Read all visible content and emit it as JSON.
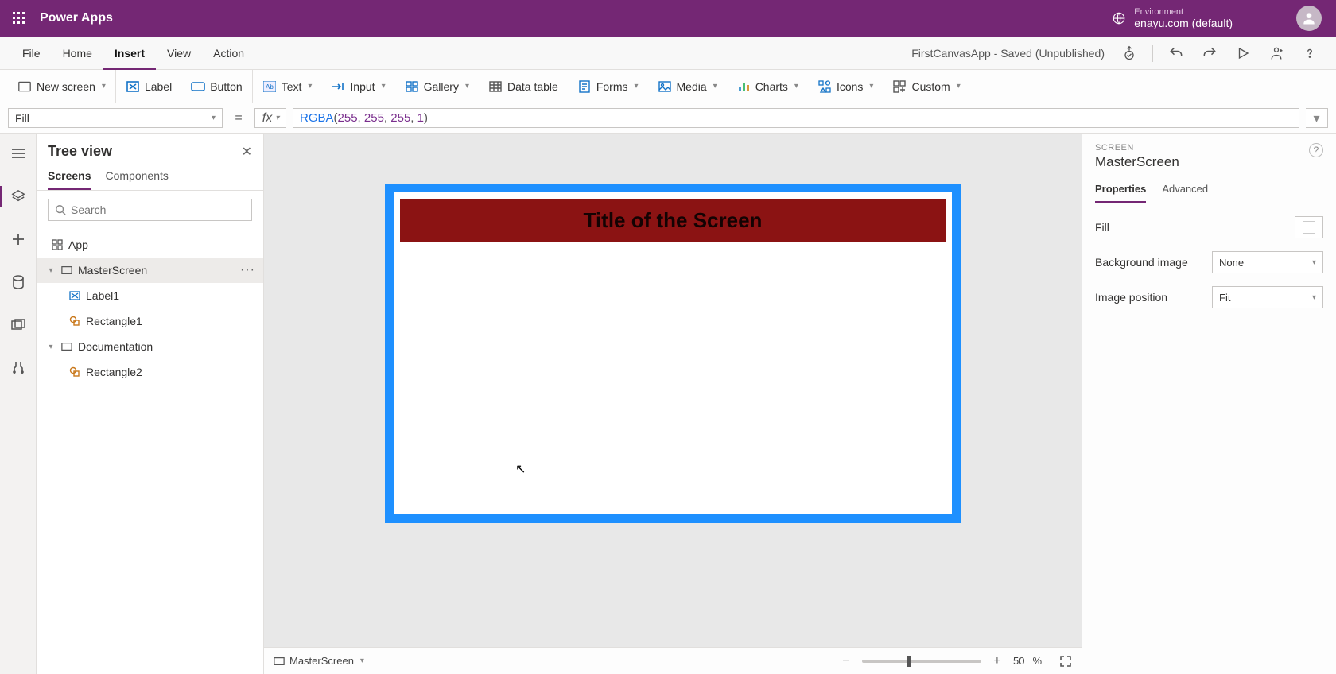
{
  "header": {
    "app_title": "Power Apps",
    "env_label": "Environment",
    "env_name": "enayu.com (default)"
  },
  "menubar": {
    "items": [
      "File",
      "Home",
      "Insert",
      "View",
      "Action"
    ],
    "active_index": 2,
    "doc_title": "FirstCanvasApp - Saved (Unpublished)"
  },
  "ribbon": {
    "new_screen": "New screen",
    "label": "Label",
    "button": "Button",
    "text": "Text",
    "input": "Input",
    "gallery": "Gallery",
    "data_table": "Data table",
    "forms": "Forms",
    "media": "Media",
    "charts": "Charts",
    "icons": "Icons",
    "custom": "Custom"
  },
  "formula": {
    "property": "Fill",
    "fn": "RGBA",
    "args": [
      "255",
      "255",
      "255",
      "1"
    ]
  },
  "tree": {
    "title": "Tree view",
    "tabs": {
      "screens": "Screens",
      "components": "Components"
    },
    "active_tab": "screens",
    "search_placeholder": "Search",
    "app": "App",
    "nodes": {
      "master": "MasterScreen",
      "label1": "Label1",
      "rect1": "Rectangle1",
      "doc": "Documentation",
      "rect2": "Rectangle2"
    },
    "selected": "master"
  },
  "canvas": {
    "title_text": "Title of the Screen",
    "colors": {
      "frame": "#1e90ff",
      "banner": "#8b1313"
    }
  },
  "statusbar": {
    "screen_name": "MasterScreen",
    "zoom_value": "50",
    "zoom_unit": "%"
  },
  "props": {
    "kicker": "SCREEN",
    "name": "MasterScreen",
    "tabs": {
      "properties": "Properties",
      "advanced": "Advanced"
    },
    "active_tab": "properties",
    "rows": {
      "fill": "Fill",
      "bg_image": "Background image",
      "bg_image_value": "None",
      "img_pos": "Image position",
      "img_pos_value": "Fit"
    }
  }
}
